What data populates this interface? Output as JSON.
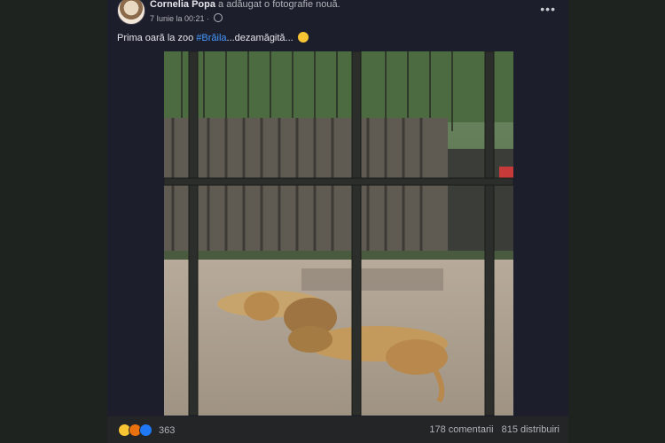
{
  "post": {
    "author": "Cornelia Popa",
    "action": "a adăugat o fotografie nouă.",
    "timestamp": "7 Iunie la 00:21",
    "more_icon": "more-horizontal-icon",
    "caption_prefix": "Prima oară la zoo ",
    "hashtag": "#Brăila",
    "caption_suffix": "...dezamăgită...",
    "reaction_count": "363",
    "comments": "178 comentarii",
    "shares": "815 distribuiri"
  },
  "colors": {
    "background": "#1e2320",
    "card": "#1d1e2c",
    "link": "#4599ff"
  }
}
